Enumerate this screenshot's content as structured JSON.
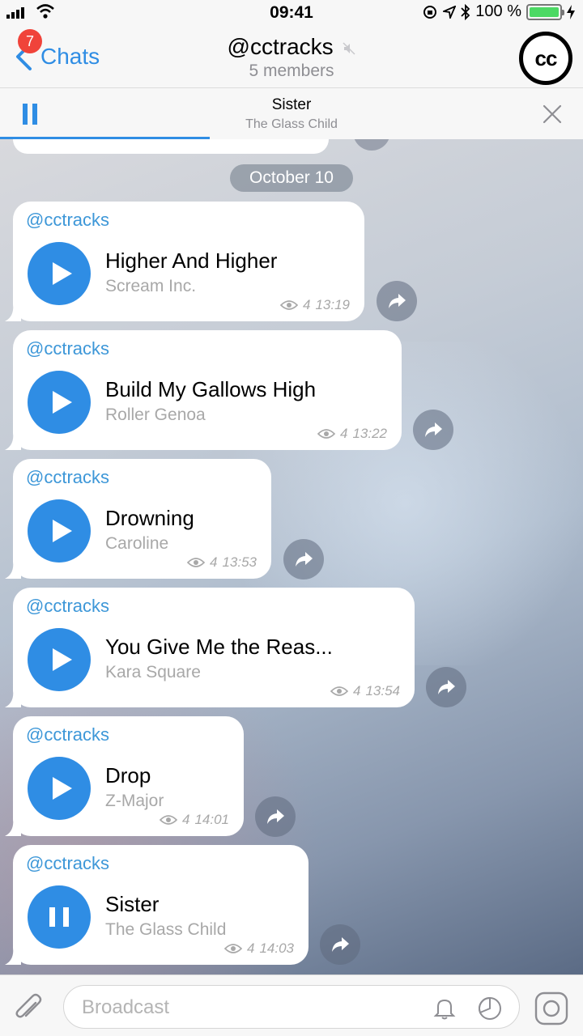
{
  "status_bar": {
    "time": "09:41",
    "battery": "100 %"
  },
  "nav": {
    "back_label": "Chats",
    "unread_badge": "7",
    "title": "@cctracks",
    "subtitle": "5 members",
    "logo_text": "cc"
  },
  "player": {
    "title": "Sister",
    "artist": "The Glass Child",
    "progress": 0.36
  },
  "chat": {
    "date_separator": "October 10",
    "messages": [
      {
        "sender": "@cctracks",
        "track": "Higher And Higher",
        "artist": "Scream Inc.",
        "views": "4",
        "time": "13:19",
        "state": "play"
      },
      {
        "sender": "@cctracks",
        "track": "Build My Gallows High",
        "artist": "Roller Genoa",
        "views": "4",
        "time": "13:22",
        "state": "play"
      },
      {
        "sender": "@cctracks",
        "track": "Drowning",
        "artist": "Caroline",
        "views": "4",
        "time": "13:53",
        "state": "play"
      },
      {
        "sender": "@cctracks",
        "track": "You Give Me the Reas...",
        "artist": "Kara Square",
        "views": "4",
        "time": "13:54",
        "state": "play"
      },
      {
        "sender": "@cctracks",
        "track": "Drop",
        "artist": "Z-Major",
        "views": "4",
        "time": "14:01",
        "state": "play"
      },
      {
        "sender": "@cctracks",
        "track": "Sister",
        "artist": "The Glass Child",
        "views": "4",
        "time": "14:03",
        "state": "pause"
      }
    ]
  },
  "input": {
    "placeholder": "Broadcast"
  },
  "colors": {
    "accent": "#2f8de4",
    "sender": "#3d97d8",
    "badge": "#f0433a"
  }
}
